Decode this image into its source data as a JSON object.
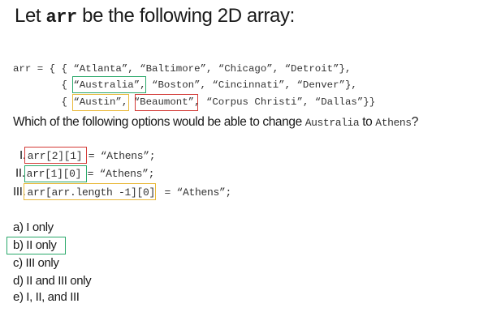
{
  "title": {
    "prefix": "Let ",
    "var": "arr",
    "suffix": " be the following 2D array:"
  },
  "array_lines": [
    "arr = { { “Atlanta”, “Baltimore”, “Chicago”, “Detroit”},",
    "        { “Australia”, “Boston”, “Cincinnati”, “Denver”},",
    "        { “Austin”, “Beaumont”, “Corpus Christi”, “Dallas”}}"
  ],
  "question": {
    "prefix": "Which of the following options would be able to change ",
    "from": "Australia",
    "mid": " to ",
    "to": "Athens",
    "suffix": "?"
  },
  "statements": [
    {
      "numeral": "I.",
      "code": "arr[2][1]",
      "rest": " = “Athens”;"
    },
    {
      "numeral": "II.",
      "code": "arr[1][0]",
      "rest": " = “Athens”;"
    },
    {
      "numeral": "III.",
      "code": "arr[arr.length -1][0]",
      "rest": " = “Athens”;"
    }
  ],
  "options": [
    "a) I only",
    "b) II only",
    "c) III only",
    "d) II and III only",
    "e) I, II, and III"
  ],
  "highlight_colors": {
    "green": "#2aa86a",
    "orange": "#e9b93b",
    "red": "#d33a36"
  }
}
